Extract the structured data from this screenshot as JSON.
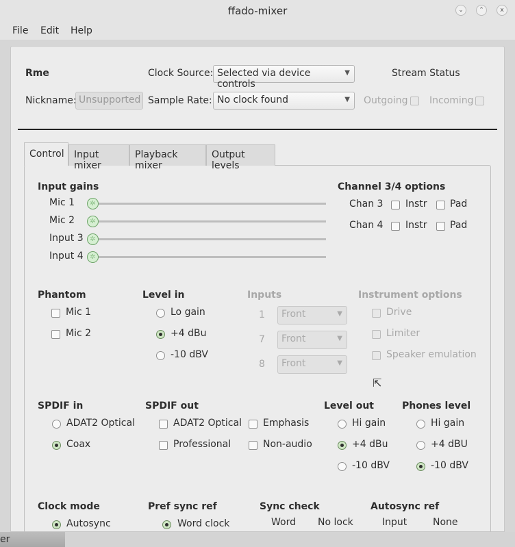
{
  "window": {
    "title": "ffado-mixer"
  },
  "menu": [
    "File",
    "Edit",
    "Help"
  ],
  "header": {
    "device": "Rme",
    "clock_source_label": "Clock Source:",
    "clock_source_value": "Selected via device controls",
    "nickname_label": "Nickname:",
    "nickname_value": "Unsupported",
    "sample_rate_label": "Sample Rate:",
    "sample_rate_value": "No clock found",
    "stream_status": "Stream Status",
    "outgoing": "Outgoing",
    "incoming": "Incoming"
  },
  "tabs": [
    "Control",
    "Input mixer",
    "Playback mixer",
    "Output levels"
  ],
  "input_gains": {
    "title": "Input gains",
    "channels": [
      "Mic 1",
      "Mic 2",
      "Input 3",
      "Input 4"
    ]
  },
  "chan34": {
    "title": "Channel 3/4 options",
    "rows": [
      "Chan 3",
      "Chan 4"
    ],
    "instr": "Instr",
    "pad": "Pad"
  },
  "phantom": {
    "title": "Phantom",
    "items": [
      "Mic 1",
      "Mic 2"
    ]
  },
  "level_in": {
    "title": "Level in",
    "options": [
      "Lo gain",
      "+4 dBu",
      "-10 dBV"
    ],
    "selected": 1
  },
  "inputs": {
    "title": "Inputs",
    "rows": [
      {
        "n": "1",
        "v": "Front"
      },
      {
        "n": "7",
        "v": "Front"
      },
      {
        "n": "8",
        "v": "Front"
      }
    ]
  },
  "instrument": {
    "title": "Instrument options",
    "items": [
      "Drive",
      "Limiter",
      "Speaker emulation"
    ]
  },
  "spdif_in": {
    "title": "SPDIF in",
    "options": [
      "ADAT2 Optical",
      "Coax"
    ],
    "selected": 1
  },
  "spdif_out": {
    "title": "SPDIF out",
    "items": [
      "ADAT2 Optical",
      "Emphasis",
      "Professional",
      "Non-audio"
    ]
  },
  "level_out": {
    "title": "Level out",
    "options": [
      "Hi gain",
      "+4 dBu",
      "-10 dBV"
    ],
    "selected": 1
  },
  "phones": {
    "title": "Phones level",
    "options": [
      "Hi gain",
      "+4 dBU",
      "-10 dBV"
    ],
    "selected": 2
  },
  "clock_mode": {
    "title": "Clock mode",
    "option": "Autosync"
  },
  "pref_sync": {
    "title": "Pref sync ref",
    "option": "Word clock"
  },
  "sync_check": {
    "title": "Sync check",
    "label": "Word",
    "value": "No lock"
  },
  "autosync_ref": {
    "title": "Autosync ref",
    "label": "Input",
    "value": "None"
  },
  "taskbar": {
    "label": "er"
  }
}
